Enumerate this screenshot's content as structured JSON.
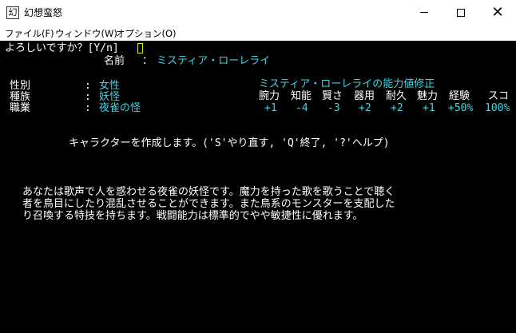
{
  "window": {
    "title": "幻想蛮怒",
    "icon": "app-icon",
    "controls": {
      "minimize": "minimize-icon",
      "maximize": "maximize-icon",
      "close": "close-icon"
    }
  },
  "menu": [
    {
      "label": "ファイル(F)"
    },
    {
      "label": "ウィンドウ(W)"
    },
    {
      "label": "オプション(O)"
    }
  ],
  "terminal": {
    "prompt": "よろしいですか？[Y/n]",
    "name_label": "名前",
    "name_sep": "：",
    "name_value": "ミスティア・ローレライ",
    "rows": [
      {
        "label": "性別",
        "sep": ":",
        "value": "女性"
      },
      {
        "label": "種族",
        "sep": ":",
        "value": "妖怪"
      },
      {
        "label": "職業",
        "sep": ":",
        "value": "夜雀の怪"
      }
    ],
    "modifier_title": "ミスティア・ローレライの能力値修正",
    "stat_headers": [
      "腕力",
      "知能",
      "賢さ",
      "器用",
      "耐久",
      "魅力",
      "経験",
      "スコ"
    ],
    "stat_values": [
      "+1",
      "-4",
      "-3",
      "+2",
      "+2",
      "+1",
      "+50%",
      "100%"
    ],
    "instruction": "キャラクターを作成します。('S'やり直す, 'Q'終了, '?'ヘルプ)",
    "description": [
      "あなたは歌声で人を惑わせる夜雀の妖怪です。魔力を持った歌を歌うことで聴く",
      "者を鳥目にしたり混乱させることができます。また鳥系のモンスターを支配した",
      "り召喚する特技を持ちます。戦闘能力は標準的でやや敏捷性に優れます。"
    ]
  },
  "colors": {
    "terminal_bg": "#000000",
    "text": "#ffffff",
    "highlight": "#3ad6e6",
    "cursor": "#e6e600"
  }
}
